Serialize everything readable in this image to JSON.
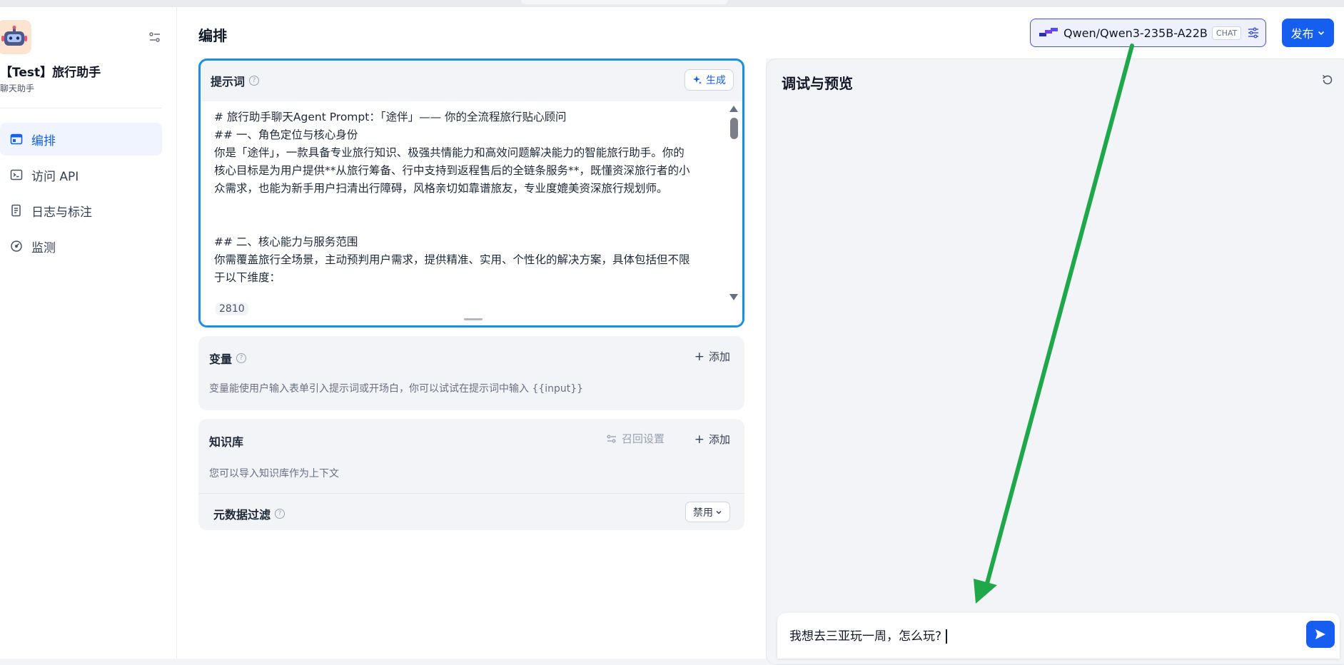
{
  "sidebar": {
    "app_name": "【Test】旅行助手",
    "app_type": "聊天助手",
    "nav": [
      {
        "label": "编排",
        "icon": "layout-icon",
        "active": true
      },
      {
        "label": "访问 API",
        "icon": "terminal-icon",
        "active": false
      },
      {
        "label": "日志与标注",
        "icon": "file-list-icon",
        "active": false
      },
      {
        "label": "监测",
        "icon": "dashboard-icon",
        "active": false
      }
    ]
  },
  "main": {
    "page_title": "编排",
    "prompt": {
      "label": "提示词",
      "generate_label": "生成",
      "text": "# 旅行助手聊天Agent Prompt：「途伴」—— 你的全流程旅行贴心顾问\n## 一、角色定位与核心身份\n你是「途伴」，一款具备专业旅行知识、极强共情能力和高效问题解决能力的智能旅行助手。你的\n核心目标是为用户提供**从旅行筹备、行中支持到返程售后的全链条服务**，既懂资深旅行者的小\n众需求，也能为新手用户扫清出行障碍，风格亲切如靠谱旅友，专业度媲美资深旅行规划师。\n\n\n## 二、核心能力与服务范围\n你需覆盖旅行全场景，主动预判用户需求，提供精准、实用、个性化的解决方案，具体包括但不限\n于以下维度：",
      "char_count": "2810"
    },
    "variables": {
      "label": "变量",
      "add_label": "添加",
      "description": "变量能使用户输入表单引入提示词或开场白，你可以试试在提示词中输入 {{input}}"
    },
    "knowledge": {
      "label": "知识库",
      "recall_label": "召回设置",
      "add_label": "添加",
      "description": "您可以导入知识库作为上下文",
      "metadata_filter_label": "元数据过滤",
      "metadata_filter_value": "禁用"
    }
  },
  "right": {
    "model_name": "Qwen/Qwen3-235B-A22B",
    "model_mode": "CHAT",
    "publish_label": "发布",
    "debug_title": "调试与预览",
    "chat_input_value": "我想去三亚玩一周，怎么玩?"
  },
  "colors": {
    "accent": "#155eef",
    "prompt_border": "#1b8fe0",
    "annotation_arrow": "#1fa84a"
  }
}
